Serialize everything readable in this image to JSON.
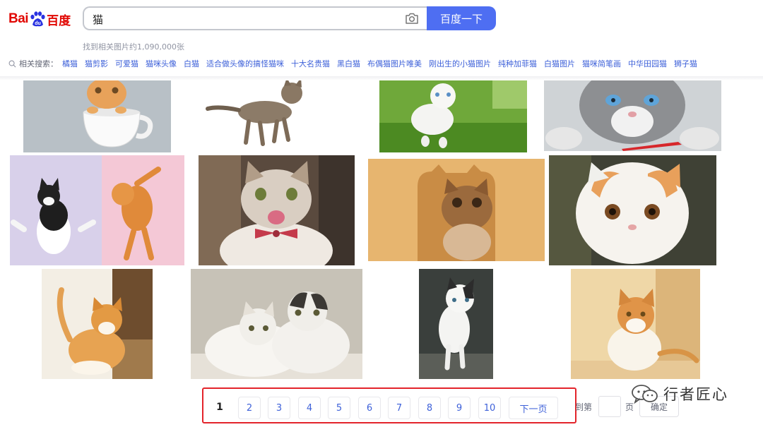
{
  "logo": {
    "text_latin_a": "Bai",
    "text_latin_b": "du",
    "text_cn": "百度"
  },
  "search": {
    "query": "猫",
    "button_label": "百度一下"
  },
  "result_count": "找到相关图片约1,090,000张",
  "related": {
    "label": "相关搜索：",
    "items": [
      "橘猫",
      "猫剪影",
      "可爱猫",
      "猫咪头像",
      "白猫",
      "适合做头像的搞怪猫咪",
      "十大名贵猫",
      "黑白猫",
      "布偶猫图片唯美",
      "刚出生的小猫图片",
      "纯种加菲猫",
      "白猫图片",
      "猫咪简笔画",
      "中华田园猫",
      "狮子猫"
    ]
  },
  "images": [
    {
      "id": "teacup-kitten",
      "subject": "orange kitten in white teacup"
    },
    {
      "id": "tabby-kitten",
      "subject": "tabby kitten looking up"
    },
    {
      "id": "white-kitten-grass",
      "subject": "white kitten on grass"
    },
    {
      "id": "grey-cat-blue-eyes",
      "subject": "grey cat with blue eyes and red pen"
    },
    {
      "id": "yoga-kittens",
      "subject": "black-white and orange kittens stretching"
    },
    {
      "id": "bowtie-cat",
      "subject": "white-tabby cat with bow tie licking lips"
    },
    {
      "id": "cat-in-box",
      "subject": "tabby kitten in cat-shaped wooden hole"
    },
    {
      "id": "exotic-shorthair",
      "subject": "white and orange exotic shorthair"
    },
    {
      "id": "munchkin-cat",
      "subject": "orange and white munchkin cat"
    },
    {
      "id": "two-fluffy-cats",
      "subject": "two fluffy white cats"
    },
    {
      "id": "walking-kitten",
      "subject": "white and black kitten walking"
    },
    {
      "id": "orange-white-cat",
      "subject": "orange and white cat sitting"
    }
  ],
  "pagination": {
    "current": "1",
    "pages": [
      "2",
      "3",
      "4",
      "5",
      "6",
      "7",
      "8",
      "9",
      "10"
    ],
    "next_label": "下一页",
    "goto_label": "到第",
    "goto_unit": "页",
    "confirm_label": "确定"
  },
  "watermark": {
    "text": "行者匠心"
  },
  "colors": {
    "brand_red": "#e10601",
    "brand_blue": "#4e6ef2",
    "link_blue": "#3e61d9",
    "highlight_red": "#e3242b"
  }
}
